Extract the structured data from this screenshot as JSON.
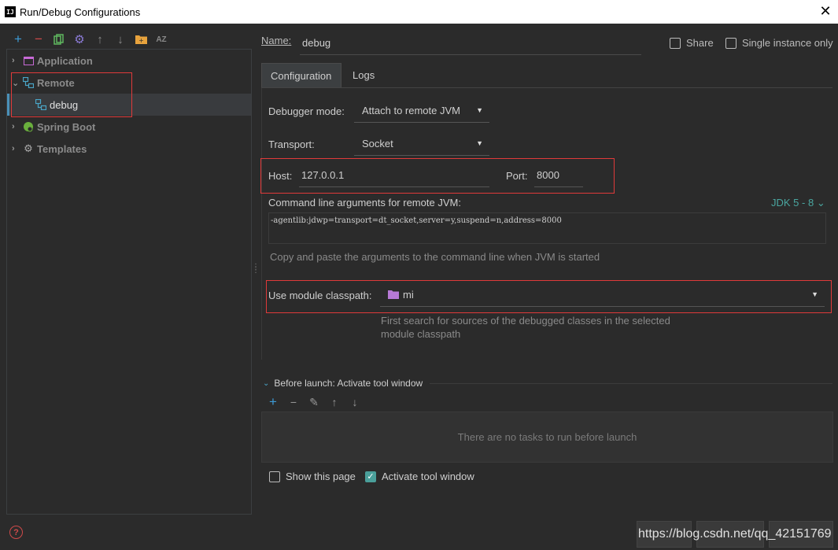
{
  "window": {
    "title": "Run/Debug Configurations",
    "app_icon_text": "IJ"
  },
  "toolbar": [
    "add",
    "remove",
    "copy",
    "edit-defaults",
    "move-up",
    "move-down",
    "folder",
    "sort"
  ],
  "tree": {
    "items": [
      {
        "label": "Application",
        "icon": "application-icon",
        "expanded": false
      },
      {
        "label": "Remote",
        "icon": "remote-icon",
        "expanded": true
      },
      {
        "label": "debug",
        "icon": "remote-icon",
        "selected": true
      },
      {
        "label": "Spring Boot",
        "icon": "spring-boot-icon",
        "expanded": false
      },
      {
        "label": "Templates",
        "icon": "wrench-icon",
        "expanded": false
      }
    ]
  },
  "form": {
    "name_label": "Name:",
    "name_value": "debug",
    "share_label": "Share",
    "single_instance_label": "Single instance only",
    "tabs": [
      "Configuration",
      "Logs"
    ],
    "debugger_mode_label": "Debugger mode:",
    "debugger_mode_value": "Attach to remote JVM",
    "transport_label": "Transport:",
    "transport_value": "Socket",
    "host_label": "Host:",
    "host_value": "127.0.0.1",
    "port_label": "Port:",
    "port_value": "8000",
    "cmd_label": "Command line arguments for remote JVM:",
    "jdk_label": "JDK 5 - 8",
    "cmd_value": "-agentlib:jdwp=transport=dt_socket,server=y,suspend=n,address=8000",
    "cmd_hint": "Copy and paste the arguments to the command line when JVM is started",
    "module_label": "Use module classpath:",
    "module_value": "mi",
    "module_hint_1": "First search for sources of the debugged classes in the selected",
    "module_hint_2": "module classpath"
  },
  "before_launch": {
    "title": "Before launch: Activate tool window",
    "empty_text": "There are no tasks to run before launch"
  },
  "bottom": {
    "show_page_label": "Show this page",
    "activate_label": "Activate tool window"
  },
  "watermark": "https://blog.csdn.net/qq_42151769",
  "colors": {
    "accent": "#4a9f9a",
    "highlight_box": "#e03a3a",
    "background": "#2b2b2b"
  }
}
